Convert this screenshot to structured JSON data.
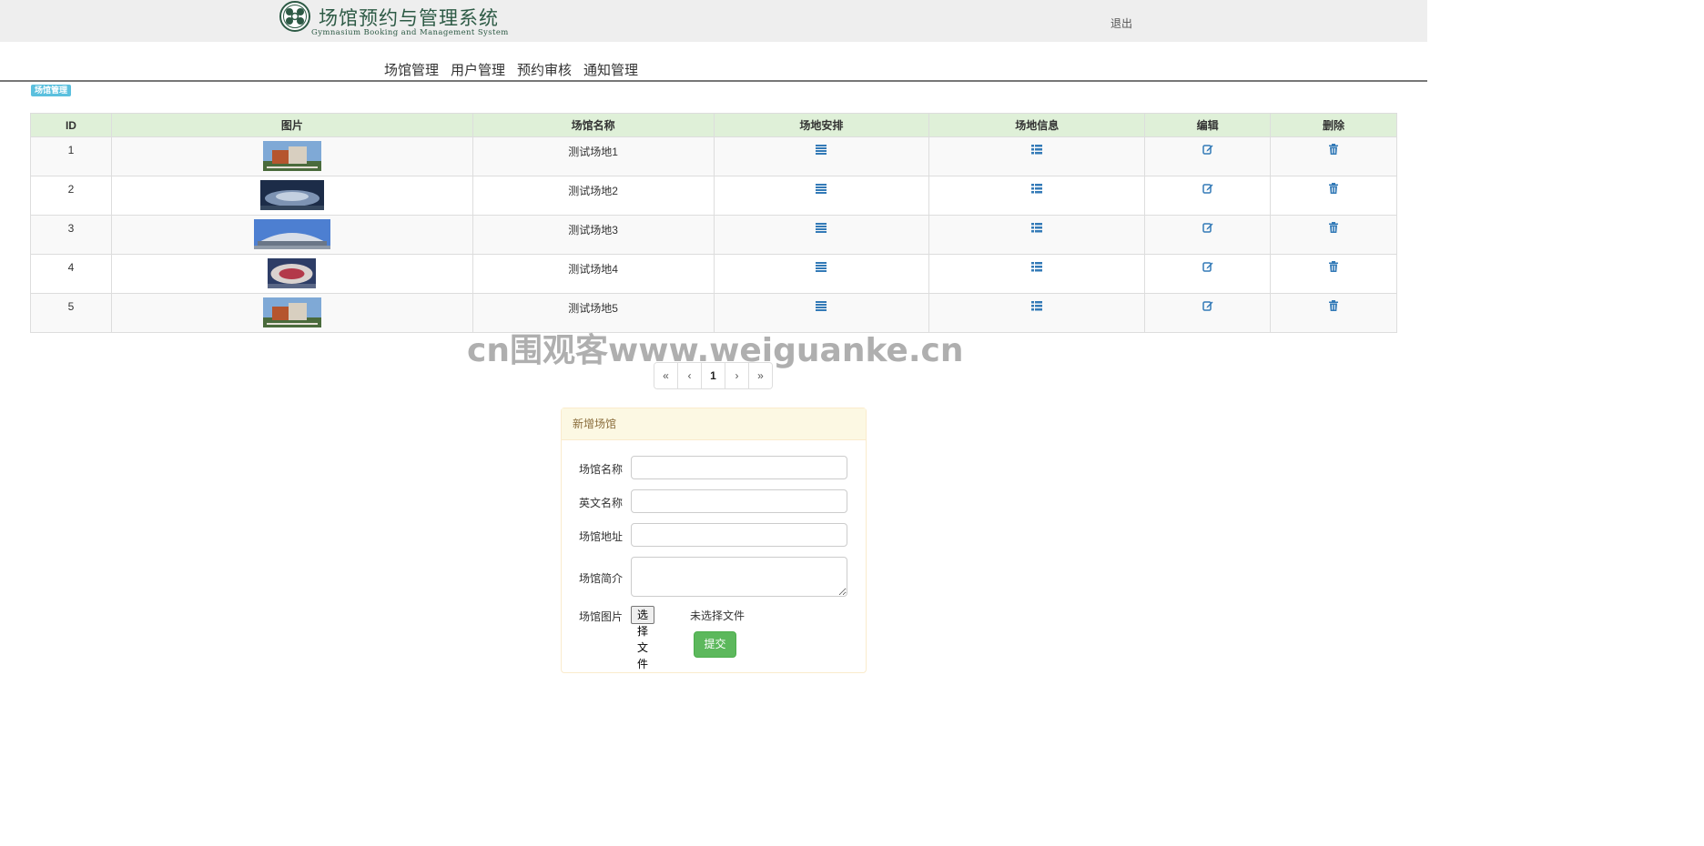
{
  "header": {
    "logo_title": "场馆预约与管理系统",
    "logo_subtitle": "Gymnasium Booking and Management System",
    "logout_label": "退出"
  },
  "nav": {
    "items": [
      "场馆管理",
      "用户管理",
      "预约审核",
      "通知管理"
    ]
  },
  "section_badge": "场馆管理",
  "table": {
    "headers": [
      "ID",
      "图片",
      "场馆名称",
      "场地安排",
      "场地信息",
      "编辑",
      "删除"
    ],
    "rows": [
      {
        "id": "1",
        "name": "测试场地1"
      },
      {
        "id": "2",
        "name": "测试场地2"
      },
      {
        "id": "3",
        "name": "测试场地3"
      },
      {
        "id": "4",
        "name": "测试场地4"
      },
      {
        "id": "5",
        "name": "测试场地5"
      }
    ],
    "action_icons": [
      "list-icon",
      "list-ul-icon",
      "edit-icon",
      "trash-icon"
    ]
  },
  "watermark": "cn围观客www.weiguanke.cn",
  "pagination": {
    "first": "«",
    "prev": "‹",
    "current": "1",
    "next": "›",
    "last": "»"
  },
  "form": {
    "title": "新增场馆",
    "fields": {
      "name_label": "场馆名称",
      "english_label": "英文名称",
      "address_label": "场馆地址",
      "intro_label": "场馆简介",
      "image_label": "场馆图片"
    },
    "file_button": "选择文件",
    "file_none": "未选择文件",
    "submit": "提交"
  },
  "colors": {
    "header_bg": "#eeeeee",
    "table_head_bg": "#dff0d8",
    "badge_bg": "#5bc0de",
    "icon_blue": "#337ab7",
    "panel_head_bg": "#fcf8e3",
    "submit_bg": "#5cb85c"
  }
}
